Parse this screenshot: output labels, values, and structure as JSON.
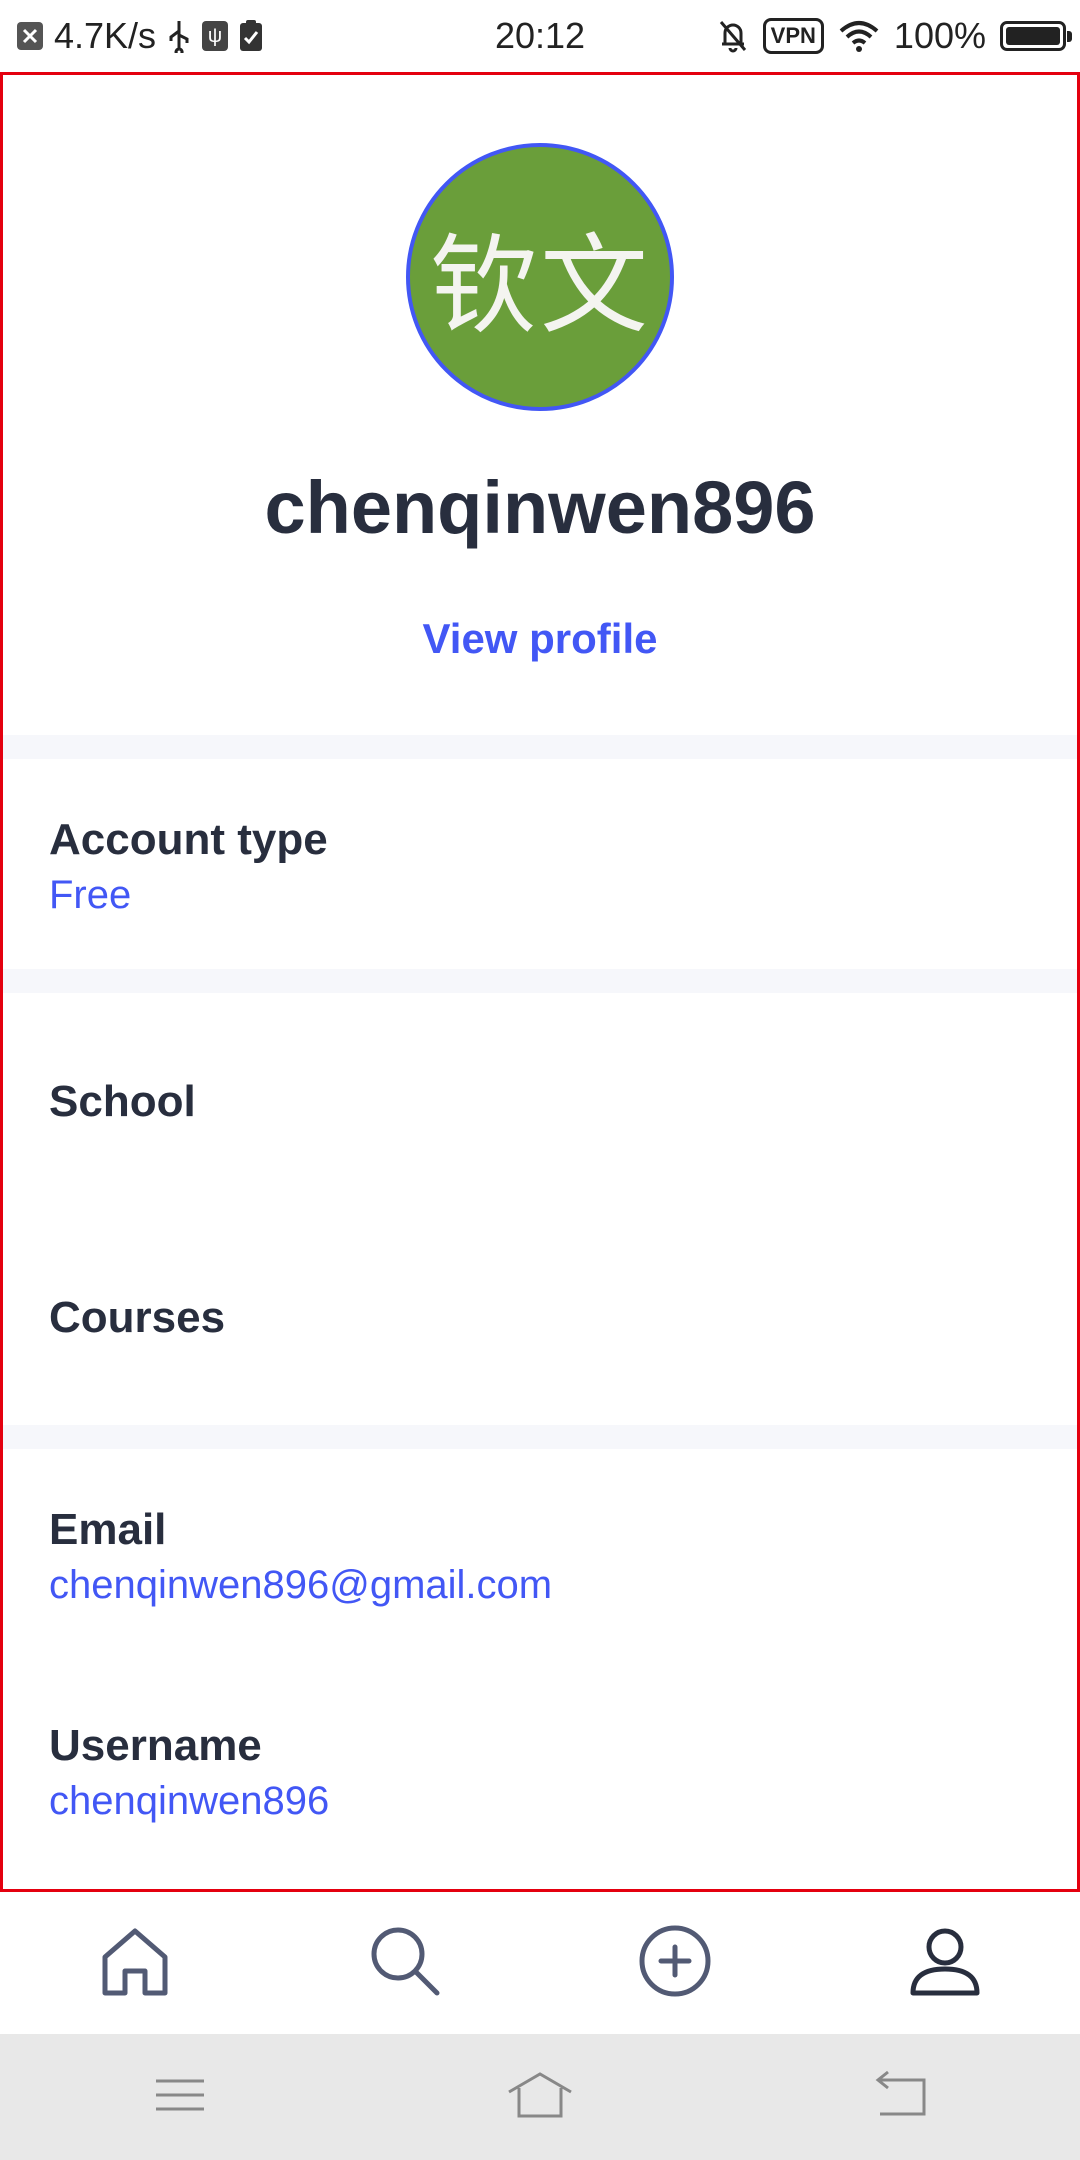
{
  "status_bar": {
    "net_speed": "4.7K/s",
    "time": "20:12",
    "vpn": "VPN",
    "battery_percent": "100%",
    "battery_level": 1.0
  },
  "profile": {
    "avatar_text": "钦文",
    "avatar_color": "#6a9e3a",
    "username": "chenqinwen896",
    "view_profile_label": "View profile"
  },
  "account": {
    "label": "Account type",
    "value": "Free"
  },
  "school": {
    "label": "School"
  },
  "courses": {
    "label": "Courses"
  },
  "email": {
    "label": "Email",
    "value": "chenqinwen896@gmail.com"
  },
  "username_field": {
    "label": "Username",
    "value": "chenqinwen896"
  },
  "tabs": [
    {
      "icon": "home-icon"
    },
    {
      "icon": "search-icon"
    },
    {
      "icon": "add-icon"
    },
    {
      "icon": "profile-icon"
    }
  ],
  "colors": {
    "accent": "#4257f5",
    "text": "#282e3e",
    "divider": "#f6f7fb"
  }
}
